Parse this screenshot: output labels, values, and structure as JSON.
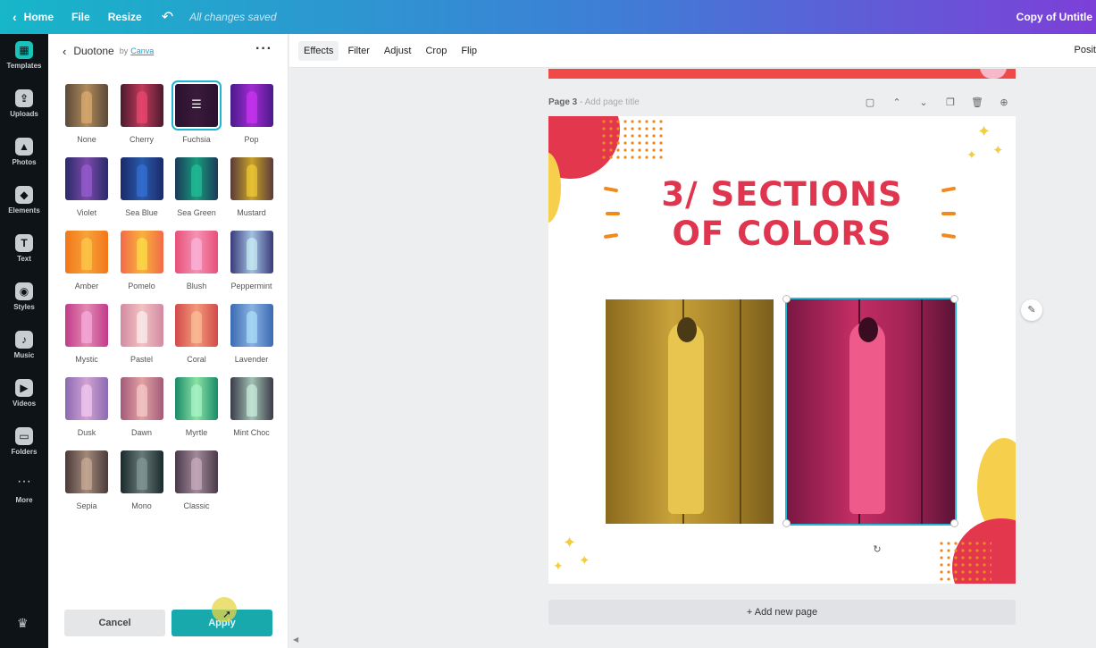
{
  "topbar": {
    "home": "Home",
    "file": "File",
    "resize": "Resize",
    "saved": "All changes saved",
    "doc_title": "Copy of Untitle"
  },
  "rail": [
    {
      "label": "Templates",
      "icon": "templates-icon"
    },
    {
      "label": "Uploads",
      "icon": "uploads-icon"
    },
    {
      "label": "Photos",
      "icon": "photos-icon"
    },
    {
      "label": "Elements",
      "icon": "elements-icon"
    },
    {
      "label": "Text",
      "icon": "text-icon"
    },
    {
      "label": "Styles",
      "icon": "styles-icon"
    },
    {
      "label": "Music",
      "icon": "music-icon"
    },
    {
      "label": "Videos",
      "icon": "videos-icon"
    },
    {
      "label": "Folders",
      "icon": "folders-icon"
    },
    {
      "label": "More",
      "icon": "more-icon"
    }
  ],
  "panel": {
    "title": "Duotone",
    "by": "by",
    "author": "Canva",
    "filters": [
      {
        "label": "None",
        "c1": "#5a4a3a",
        "c2": "#b08a5a"
      },
      {
        "label": "Cherry",
        "c1": "#4a1a2e",
        "c2": "#c23a5a"
      },
      {
        "label": "Fuchsia",
        "c1": "#2a1030",
        "c2": "#3a1a3a"
      },
      {
        "label": "Pop",
        "c1": "#4a1a8a",
        "c2": "#a22ad2"
      },
      {
        "label": "Violet",
        "c1": "#2a2a6a",
        "c2": "#7a4aa8"
      },
      {
        "label": "Sea Blue",
        "c1": "#1a2a6a",
        "c2": "#2a5aaa"
      },
      {
        "label": "Sea Green",
        "c1": "#1a3a5a",
        "c2": "#1a9a7a"
      },
      {
        "label": "Mustard",
        "c1": "#5a3a3a",
        "c2": "#c8a22a"
      },
      {
        "label": "Amber",
        "c1": "#f2761a",
        "c2": "#f7a23a"
      },
      {
        "label": "Pomelo",
        "c1": "#f26a4a",
        "c2": "#f7b23a"
      },
      {
        "label": "Blush",
        "c1": "#e8507a",
        "c2": "#f492b2"
      },
      {
        "label": "Peppermint",
        "c1": "#3a3a7a",
        "c2": "#a2c2e2"
      },
      {
        "label": "Mystic",
        "c1": "#c23a8a",
        "c2": "#e28ab2"
      },
      {
        "label": "Pastel",
        "c1": "#d28aa2",
        "c2": "#f2c2c2"
      },
      {
        "label": "Coral",
        "c1": "#d24a4a",
        "c2": "#f29a7a"
      },
      {
        "label": "Lavender",
        "c1": "#3a6ab2",
        "c2": "#8ab2e2"
      },
      {
        "label": "Dusk",
        "c1": "#8a6ab2",
        "c2": "#d2a2d2"
      },
      {
        "label": "Dawn",
        "c1": "#a25a7a",
        "c2": "#e2a2a2"
      },
      {
        "label": "Myrtle",
        "c1": "#1a8a6a",
        "c2": "#8ae2a2"
      },
      {
        "label": "Mint Choc",
        "c1": "#3a3a4a",
        "c2": "#a2c2b2"
      },
      {
        "label": "Sepia",
        "c1": "#4a3a3a",
        "c2": "#a28a7a"
      },
      {
        "label": "Mono",
        "c1": "#1a2a2a",
        "c2": "#6a7a7a"
      },
      {
        "label": "Classic",
        "c1": "#4a3a4a",
        "c2": "#a28a9a"
      }
    ],
    "selected": "Fuchsia",
    "cancel": "Cancel",
    "apply": "Apply"
  },
  "toolbar": {
    "tools": [
      "Effects",
      "Filter",
      "Adjust",
      "Crop",
      "Flip"
    ],
    "active": "Effects",
    "position": "Posit"
  },
  "page": {
    "label": "Page 3",
    "separator": " - ",
    "add_title": "Add page title",
    "headline_1": "3/ SECTIONS",
    "headline_2": "OF COLORS"
  },
  "add_page": "+ Add new page",
  "colors": {
    "accent": "#18a9ad",
    "headline": "#e0354f",
    "selection": "#25b7d6"
  }
}
